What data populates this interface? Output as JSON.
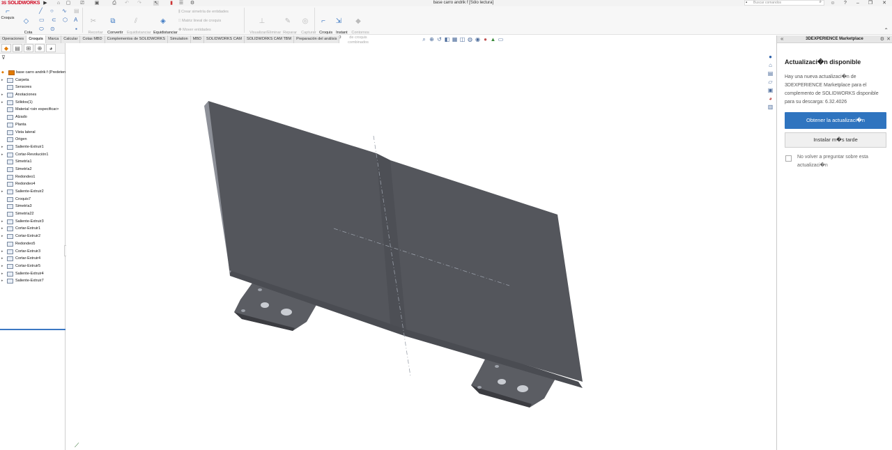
{
  "app": {
    "logo_text": "SOLIDWORKS",
    "logo_prefix": "3S",
    "brand_color": "#d0021b"
  },
  "window": {
    "title": "base carro andrik f [Sólo lectura]"
  },
  "search": {
    "placeholder": "Buscar comandos"
  },
  "ribbon": {
    "croquis": "Croquis",
    "cota": "Cota\ninteligente",
    "recortar": "Recortar\nentidades",
    "convertir": "Convertir\nentidades",
    "equidistanciar": "Equidistanciar\nentidades",
    "equid_superficie": "Equidistanciar\nen superficie",
    "crear_simetria": "Crear simetría de entidades",
    "matriz_lineal": "Matriz lineal de croquis",
    "mover": "Mover entidades",
    "visualizar": "Visualizar/Eliminar\nrelaciones",
    "reparar": "Reparar\ncroquis",
    "capturar": "Capturar\nrápido",
    "croquis_rapido": "Croquis\nrápido",
    "instant2d": "Instant\n2D",
    "contornos": "Contornos\nde croquis\ncombinados"
  },
  "tabs": [
    "Operaciones",
    "Croquis",
    "Marca",
    "Calcular",
    "Cotas MBD",
    "Complementos de SOLIDWORKS",
    "Simulation",
    "MBD",
    "SOLIDWORKS CAM",
    "SOLIDWORKS CAM TBM",
    "Preparación del análisis"
  ],
  "active_tab": "Croquis",
  "tree": {
    "root": "base carro andrik f  (Predeterminado)",
    "items": [
      {
        "label": "Carpeta",
        "expand": true
      },
      {
        "label": "Sensores",
        "expand": false
      },
      {
        "label": "Anotaciones",
        "expand": true
      },
      {
        "label": "Sólidos(1)",
        "expand": true
      },
      {
        "label": "Material <sin especificar>",
        "expand": false
      },
      {
        "label": "Alzado",
        "expand": false
      },
      {
        "label": "Planta",
        "expand": false
      },
      {
        "label": "Vista lateral",
        "expand": false
      },
      {
        "label": "Origen",
        "expand": false
      },
      {
        "label": "Saliente-Extruir1",
        "expand": true
      },
      {
        "label": "Cortar-Revolución1",
        "expand": true
      },
      {
        "label": "Simetría1",
        "expand": false
      },
      {
        "label": "Simetría2",
        "expand": false
      },
      {
        "label": "Redondeo1",
        "expand": false
      },
      {
        "label": "Redondeo4",
        "expand": false
      },
      {
        "label": "Saliente-Extruir2",
        "expand": true
      },
      {
        "label": "Croquis7",
        "expand": false
      },
      {
        "label": "Simetría3",
        "expand": false
      },
      {
        "label": "Simetría22",
        "expand": false
      },
      {
        "label": "Saliente-Extruir3",
        "expand": true
      },
      {
        "label": "Cortar-Extruir1",
        "expand": true
      },
      {
        "label": "Cortar-Extruir2",
        "expand": true
      },
      {
        "label": "Redondeo5",
        "expand": false
      },
      {
        "label": "Cortar-Extruir3",
        "expand": true
      },
      {
        "label": "Cortar-Extruir4",
        "expand": true
      },
      {
        "label": "Cortar-Extruir5",
        "expand": true
      },
      {
        "label": "Saliente-Extruir4",
        "expand": true
      },
      {
        "label": "Saliente-Extruir7",
        "expand": true
      }
    ]
  },
  "panel": {
    "header": "3DEXPERIENCE Marketplace",
    "title": "Actualizaci�n disponible",
    "body": "Hay una nueva actualizaci�n de 3DEXPERIENCE Marketplace para el complemento de SOLIDWORKS disponible para su descarga: 6.32.4026",
    "primary_button": "Obtener la actualizaci�n",
    "secondary_button": "Instalar m�s tarde",
    "checkbox_label": "No volver a preguntar sobre esta actualizaci�n",
    "checkbox_checked": false,
    "accent_color": "#2f74bf"
  },
  "icons": {
    "titlebar": [
      "play-icon",
      "home-icon",
      "new-file-icon",
      "open-icon",
      "save-icon",
      "undo-icon",
      "redo-icon",
      "select-icon",
      "rebuild-icon",
      "file-properties-icon",
      "options-icon"
    ],
    "headsup": [
      "zoom-to-fit-icon",
      "zoom-area-icon",
      "previous-view-icon",
      "section-view-icon",
      "dynamic-annotation-icon",
      "view-orientation-icon",
      "display-style-icon",
      "hide-show-icon",
      "appearance-icon",
      "scene-icon",
      "view-settings-icon"
    ],
    "taskpane": [
      "resources-icon",
      "home-icon",
      "design-library-icon",
      "file-explorer-icon",
      "view-palette-icon",
      "appearances-icon",
      "custom-properties-icon"
    ]
  }
}
